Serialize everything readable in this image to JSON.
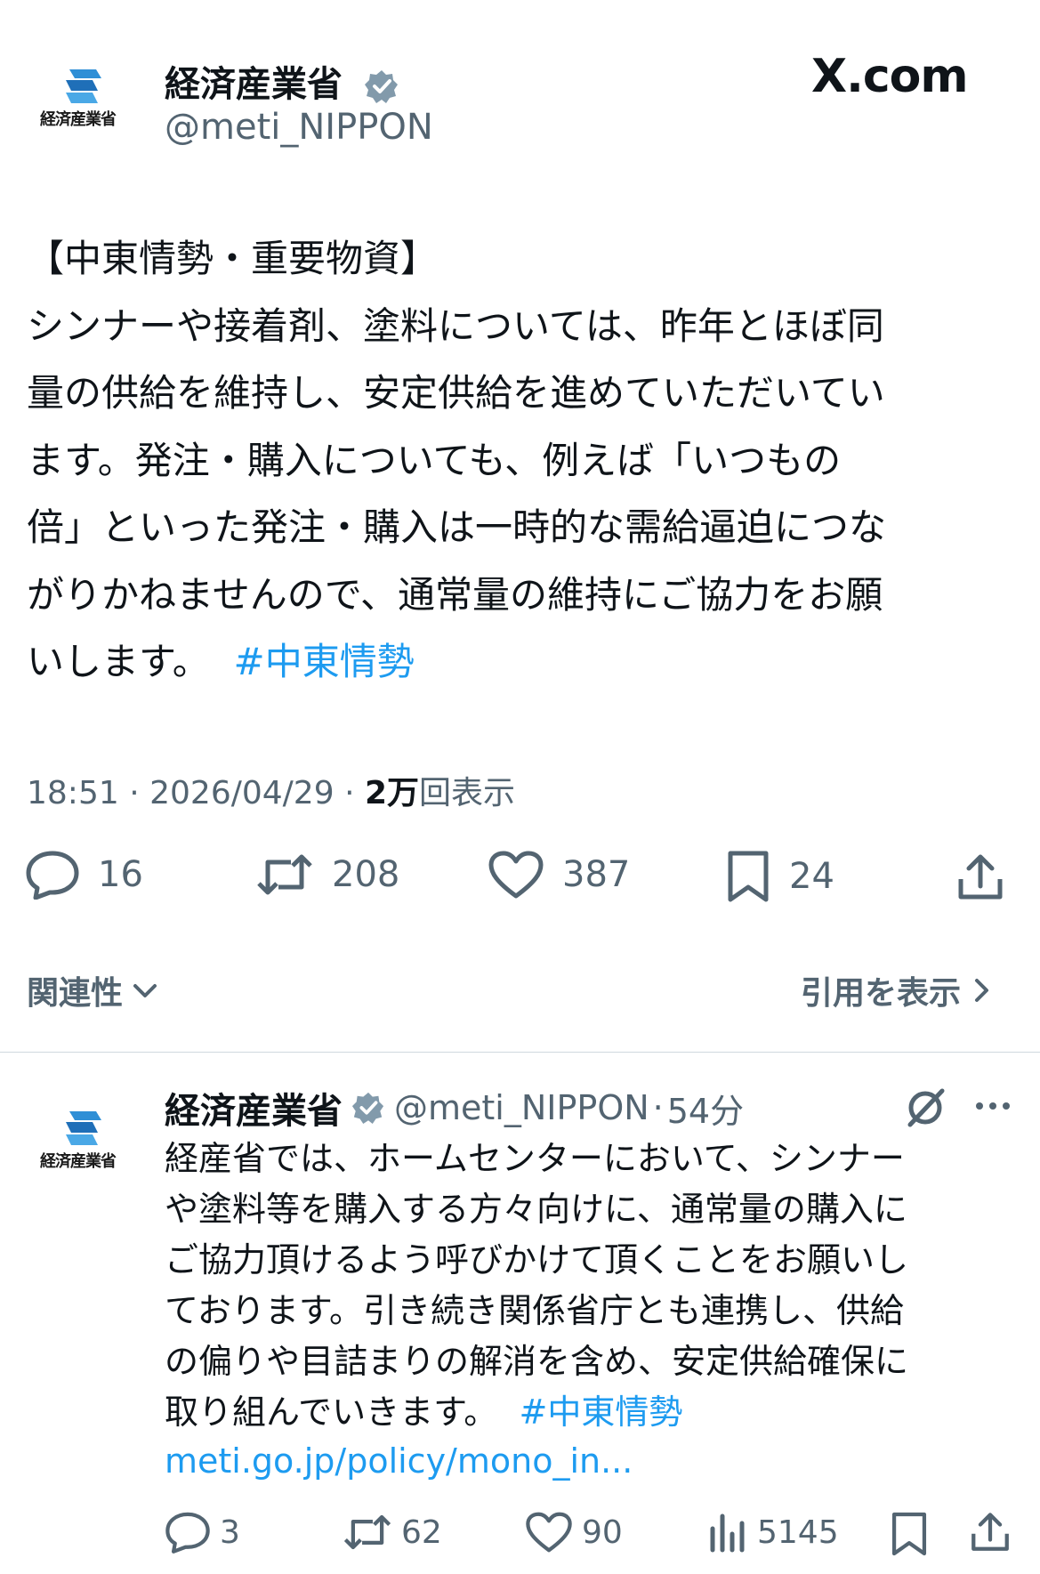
{
  "header": {
    "org_logo_text": "経済産業省",
    "name": "経済産業省",
    "handle": "@meti_NIPPON",
    "site": "X.com"
  },
  "post": {
    "lines": [
      "【中東情勢・重要物資】",
      "シンナーや接着剤、塗料については、昨年とほぼ同",
      "量の供給を維持し、安定供給を進めていただいてい",
      "ます。発注・購入についても、例えば「いつもの",
      "倍」といった発注・購入は一時的な需給逼迫につな",
      "がりかねませんので、通常量の維持にご協力をお願"
    ],
    "last_line": "いします。",
    "hashtag": "#中東情勢",
    "time": "18:51",
    "date": "2026/04/29",
    "views_count": "2万",
    "views_label": "回表示",
    "sep": "·"
  },
  "actions": {
    "replies": "16",
    "reposts": "208",
    "likes": "387",
    "bookmarks": "24"
  },
  "sort": {
    "relevance_label": "関連性",
    "quotes_label": "引用を表示"
  },
  "reply": {
    "name": "経済産業省",
    "handle": "@meti_NIPPON",
    "sep": "·",
    "age": "54分",
    "lines": [
      "経産省では、ホームセンターにおいて、シンナー",
      "や塗料等を購入する方々向けに、通常量の購入に",
      "ご協力頂けるよう呼びかけて頂くことをお願いし",
      "ております。引き続き関係省庁とも連携し、供給",
      "の偏りや目詰まりの解消を含め、安定供給確保に"
    ],
    "last_line": "取り組んでいきます。",
    "hashtag": "#中東情勢",
    "link": "meti.go.jp/policy/mono_in...",
    "replies": "3",
    "reposts": "62",
    "likes": "90",
    "views": "5145"
  },
  "colors": {
    "accent": "#1d9bf0",
    "secondary_text": "#536471",
    "primary_text": "#0f1419",
    "logo_blue": "#2f8fd6"
  }
}
